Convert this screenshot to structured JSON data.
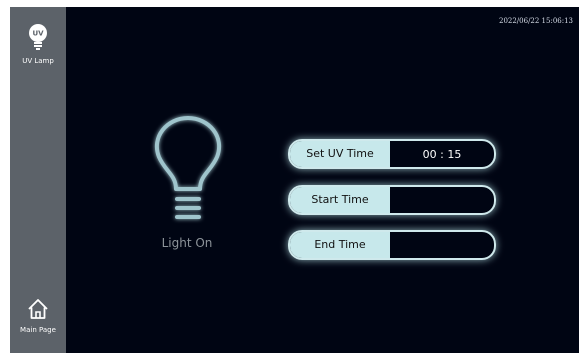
{
  "sidebar": {
    "items": [
      {
        "label": "UV Lamp",
        "icon": "uv-lamp-icon"
      },
      {
        "label": "Main Page",
        "icon": "home-icon"
      }
    ]
  },
  "header": {
    "datetime": "2022/06/22 15:06:13"
  },
  "bulb": {
    "status_label": "Light On",
    "icon": "lightbulb-icon"
  },
  "fields": {
    "uv_time": {
      "label": "Set UV Time",
      "value": "00 : 15"
    },
    "start_time": {
      "label": "Start Time",
      "value": ""
    },
    "end_time": {
      "label": "End Time",
      "value": ""
    }
  },
  "colors": {
    "background": "#000513",
    "sidebar": "#5c6269",
    "accent": "#c7e8eb"
  }
}
